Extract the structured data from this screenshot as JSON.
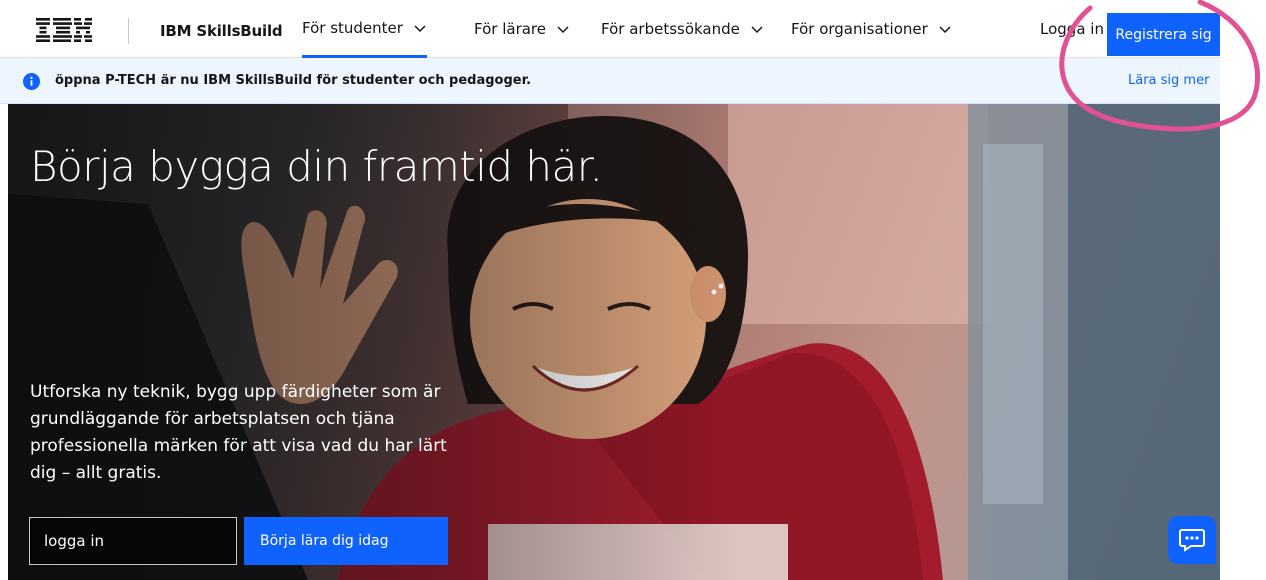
{
  "nav": {
    "logo_text": "IBM",
    "brand": "IBM SkillsBuild",
    "items": [
      {
        "label": "För studenter",
        "active": true
      },
      {
        "label": "För lärare",
        "active": false
      },
      {
        "label": "För arbetssökande",
        "active": false
      },
      {
        "label": "För organisationer",
        "active": false
      }
    ],
    "login": "Logga in",
    "register": "Registrera sig"
  },
  "banner": {
    "text": "öppna P-TECH är nu IBM SkillsBuild för studenter och pedagoger.",
    "link": "Lära sig mer"
  },
  "hero": {
    "title": "Börja bygga din framtid här.",
    "copy": "Utforska ny teknik, bygg upp färdigheter som är grundläggande för arbetsplatsen och tjäna professionella märken för att visa vad du har lärt dig – allt gratis.",
    "input_value": "logga in",
    "cta": "Börja lära dig idag"
  },
  "colors": {
    "accent": "#0f62fe",
    "banner_bg": "#edf5ff",
    "annotation": "#e05294"
  },
  "icons": {
    "info": "info-icon",
    "chevron": "chevron-down-icon",
    "chat": "chat-icon"
  }
}
